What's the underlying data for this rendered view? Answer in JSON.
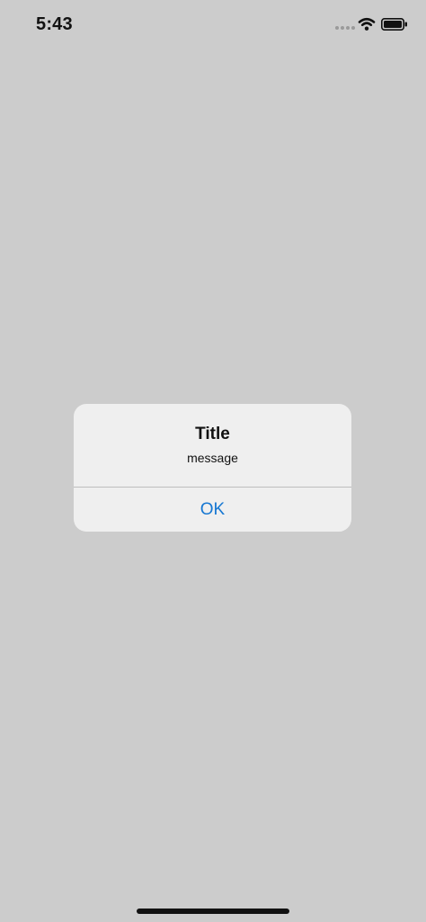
{
  "status_bar": {
    "time": "5:43",
    "icons": [
      "signal-dots-icon",
      "wifi-icon",
      "battery-icon"
    ]
  },
  "alert": {
    "title": "Title",
    "message": "message",
    "buttons": [
      {
        "label": "OK",
        "color": "#1677d2"
      }
    ]
  },
  "colors": {
    "background": "#cccccc",
    "alert_background": "#efefef",
    "separator": "#bdbdbd",
    "text": "#111111"
  }
}
